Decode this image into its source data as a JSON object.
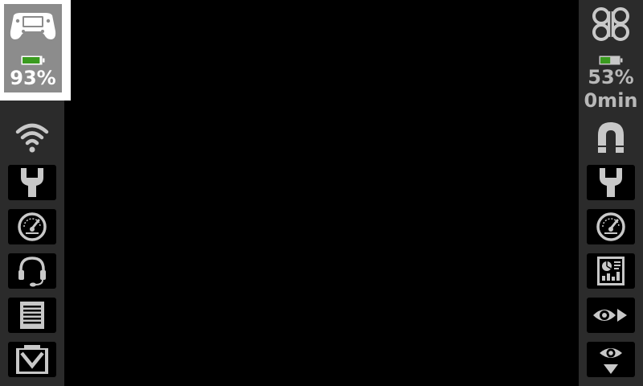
{
  "left_panel": {
    "controller": {
      "icon": "gamepad-icon",
      "battery_percent": "93%",
      "battery_level": 0.93,
      "battery_color": "#3a9b1f"
    },
    "icons": [
      {
        "name": "wifi-icon"
      },
      {
        "name": "wrench-icon"
      },
      {
        "name": "speedometer-icon"
      },
      {
        "name": "headset-icon"
      },
      {
        "name": "document-icon"
      },
      {
        "name": "collapse-down-icon"
      }
    ]
  },
  "right_panel": {
    "drone": {
      "icon": "quadcopter-icon",
      "battery_percent": "53%",
      "battery_level": 0.53,
      "battery_color": "#3a9b1f",
      "flight_time": "0min"
    },
    "icons": [
      {
        "name": "magnet-icon"
      },
      {
        "name": "wrench-icon"
      },
      {
        "name": "speedometer-icon"
      },
      {
        "name": "telemetry-dashboard-icon"
      },
      {
        "name": "eye-forward-icon"
      },
      {
        "name": "eye-down-icon"
      }
    ]
  },
  "colors": {
    "sidebar_bg": "#2b2b2b",
    "icon_gray": "#c8c8c8",
    "canvas_bg": "#000000"
  }
}
